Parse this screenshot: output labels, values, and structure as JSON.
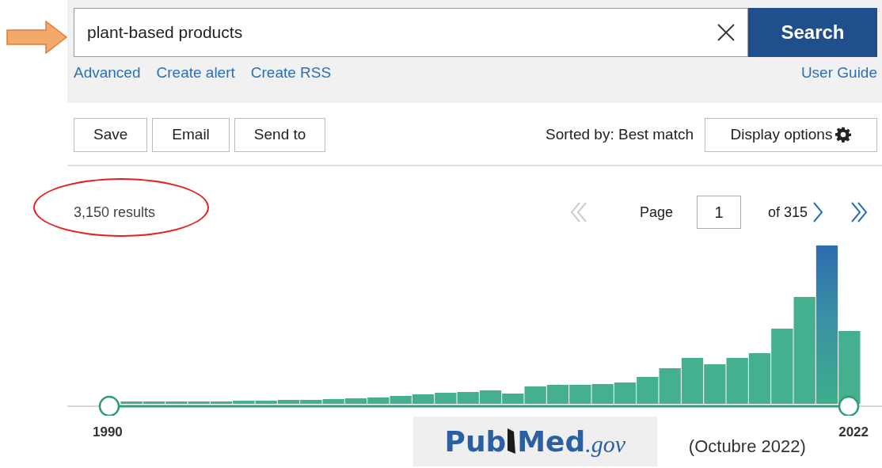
{
  "search": {
    "value": "plant-based products",
    "button": "Search"
  },
  "links": [
    "Advanced",
    "Create alert",
    "Create RSS"
  ],
  "user_guide": "User Guide",
  "actions": [
    "Save",
    "Email",
    "Send to"
  ],
  "sort": "Sorted by: Best match",
  "display_options": "Display options",
  "results": "3,150 results",
  "pagination": {
    "page_label": "Page",
    "page": "1",
    "of": "of 315",
    "first": {
      "disabled": true
    },
    "next": {
      "disabled": false
    },
    "last": {
      "disabled": false
    }
  },
  "timeline": {
    "start": "1990",
    "end": "2022"
  },
  "logo": {
    "parts": [
      "Pub",
      "Med"
    ],
    "suffix": ".gov"
  },
  "caption": "(Octubre 2022)"
}
